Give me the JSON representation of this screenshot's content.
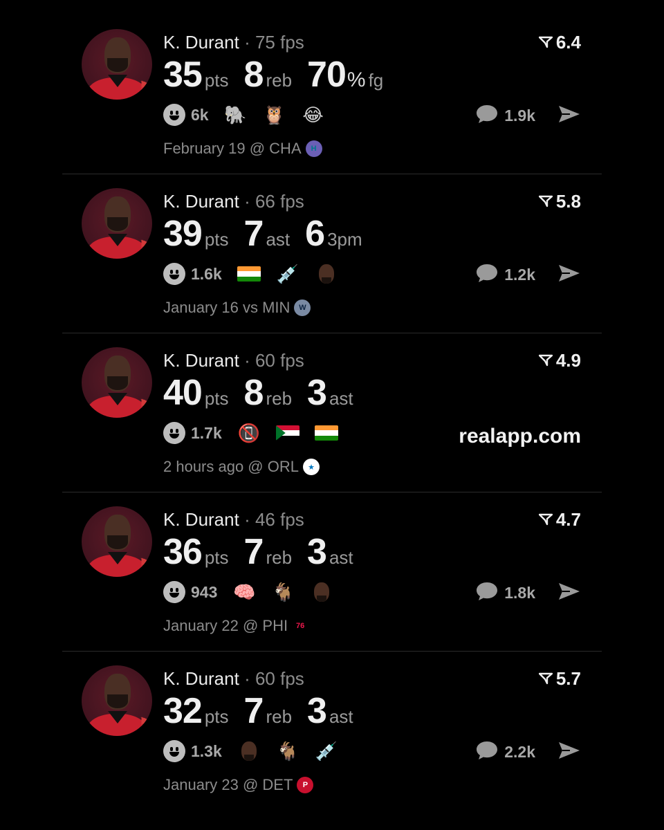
{
  "posts": [
    {
      "player": "K. Durant",
      "separator": "·",
      "fps": "75 fps",
      "rating": "6.4",
      "stats": [
        {
          "num": "35",
          "unit": "pts",
          "pct": ""
        },
        {
          "num": "8",
          "unit": "reb",
          "pct": ""
        },
        {
          "num": "70",
          "unit": "fg",
          "pct": "%"
        }
      ],
      "reaction_count": "6k",
      "reaction_emojis": [
        "elephant-icon",
        "owl-icon",
        "laughing-face-icon"
      ],
      "comment_count": "1.9k",
      "date": "February 19 @ CHA",
      "team_icon": "hornets-logo-icon"
    },
    {
      "player": "K. Durant",
      "separator": "·",
      "fps": "66 fps",
      "rating": "5.8",
      "stats": [
        {
          "num": "39",
          "unit": "pts",
          "pct": ""
        },
        {
          "num": "7",
          "unit": "ast",
          "pct": ""
        },
        {
          "num": "6",
          "unit": "3pm",
          "pct": ""
        }
      ],
      "reaction_count": "1.6k",
      "reaction_emojis": [
        "india-flag-icon",
        "syringe-icon",
        "player-face-icon"
      ],
      "comment_count": "1.2k",
      "date": "January 16 vs MIN",
      "team_icon": "timberwolves-logo-icon"
    },
    {
      "player": "K. Durant",
      "separator": "·",
      "fps": "60 fps",
      "rating": "4.9",
      "stats": [
        {
          "num": "40",
          "unit": "pts",
          "pct": ""
        },
        {
          "num": "8",
          "unit": "reb",
          "pct": ""
        },
        {
          "num": "3",
          "unit": "ast",
          "pct": ""
        }
      ],
      "reaction_count": "1.7k",
      "reaction_emojis": [
        "no-mobile-phones-icon",
        "sudan-flag-icon",
        "india-flag-icon"
      ],
      "promo": "realapp.com",
      "date": "2 hours ago @ ORL",
      "team_icon": "magic-logo-icon"
    },
    {
      "player": "K. Durant",
      "separator": "·",
      "fps": "46 fps",
      "rating": "4.7",
      "stats": [
        {
          "num": "36",
          "unit": "pts",
          "pct": ""
        },
        {
          "num": "7",
          "unit": "reb",
          "pct": ""
        },
        {
          "num": "3",
          "unit": "ast",
          "pct": ""
        }
      ],
      "reaction_count": "943",
      "reaction_emojis": [
        "brain-icon",
        "goat-icon",
        "player-face-icon"
      ],
      "comment_count": "1.8k",
      "date": "January 22 @ PHI",
      "team_icon": "76ers-logo-icon"
    },
    {
      "player": "K. Durant",
      "separator": "·",
      "fps": "60 fps",
      "rating": "5.7",
      "stats": [
        {
          "num": "32",
          "unit": "pts",
          "pct": ""
        },
        {
          "num": "7",
          "unit": "reb",
          "pct": ""
        },
        {
          "num": "3",
          "unit": "ast",
          "pct": ""
        }
      ],
      "reaction_count": "1.3k",
      "reaction_emojis": [
        "player-face-icon",
        "goat-icon",
        "syringe-icon"
      ],
      "comment_count": "2.2k",
      "date": "January 23 @ DET",
      "team_icon": "pistons-logo-icon"
    }
  ],
  "colors": {
    "background": "#000000",
    "text_primary": "#efefef",
    "text_secondary": "#8c8c8c",
    "divider": "#2b2b2b",
    "avatar_bg": "#451420",
    "jersey_red": "#c8202e"
  }
}
